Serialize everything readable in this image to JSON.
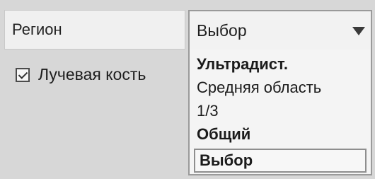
{
  "form": {
    "region_label": "Регион",
    "region_select_value": "Выбор",
    "region_options": [
      "Ультрадист.",
      "Средняя область",
      "1/3",
      "Общий",
      "Выбор"
    ],
    "selected_option_index": 4,
    "checkbox": {
      "label": "Лучевая кость",
      "checked": true
    }
  }
}
